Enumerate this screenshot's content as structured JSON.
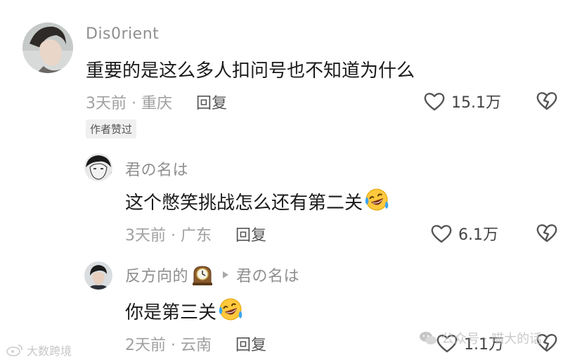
{
  "comments": [
    {
      "username": "Dis0rient",
      "content": "重要的是这么多人扣问号也不知道为什么",
      "meta": "3天前 · 重庆",
      "reply_label": "回复",
      "like_count": "15.1万",
      "badge": "作者赞过"
    },
    {
      "username": "君の名は",
      "content": "这个憋笑挑战怎么还有第二关",
      "meta": "3天前 · 广东",
      "reply_label": "回复",
      "like_count": "6.1万"
    },
    {
      "username": "反方向的",
      "reply_to": "君の名は",
      "content": "你是第三关",
      "meta": "2天前 · 云南",
      "reply_label": "回复",
      "like_count": "1.1万"
    }
  ],
  "watermarks": {
    "left": "大数跨境",
    "right": "公众号 · 喵大的话"
  },
  "icons": {
    "like": "heart-outline-icon",
    "dislike": "broken-heart-icon",
    "emoji": "laugh-cry-emoji-icon",
    "clock": "mantel-clock-icon",
    "reply_arrow": "triangle-right-icon"
  }
}
